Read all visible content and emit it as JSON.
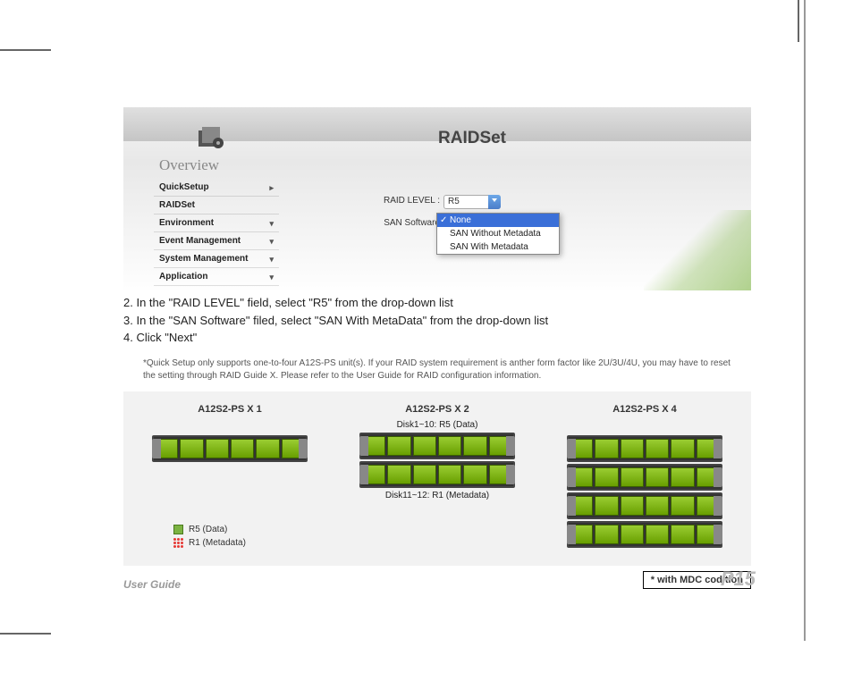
{
  "screenshot": {
    "title": "RAIDSet",
    "overview": "Overview",
    "sidebar": [
      "QuickSetup",
      "RAIDSet",
      "Environment",
      "Event Management",
      "System Management",
      "Application"
    ],
    "raid_label": "RAID LEVEL :",
    "san_label": "SAN Software",
    "raid_value": "R5",
    "dropdown": {
      "selected": "None",
      "opt1": "SAN Without Metadata",
      "opt2": "SAN With Metadata"
    }
  },
  "steps": {
    "s2": "2. In the \"RAID LEVEL\" field, select \"R5\" from the drop-down list",
    "s3": "3. In the \"SAN Software\" filed, select \"SAN With MetaData\" from the drop-down list",
    "s4": "4. Click \"Next\""
  },
  "footnote": "*Quick Setup only supports one-to-four A12S-PS unit(s). If your RAID system requirement is anther form factor like 2U/3U/4U, you may have to reset the setting through RAID Guide X.  Please refer to the User Guide for RAID configuration information.",
  "diagram": {
    "col1": "A12S2-PS X 1",
    "col2": "A12S2-PS X 2",
    "col3": "A12S2-PS X 4",
    "disk1": "Disk1~10: R5 (Data)",
    "disk2": "Disk11~12: R1 (Metadata)",
    "legend1": "R5 (Data)",
    "legend2": "R1 (Metadata)",
    "mdc": "* with MDC codition"
  },
  "footer": {
    "left": "User Guide",
    "right": "P15"
  }
}
